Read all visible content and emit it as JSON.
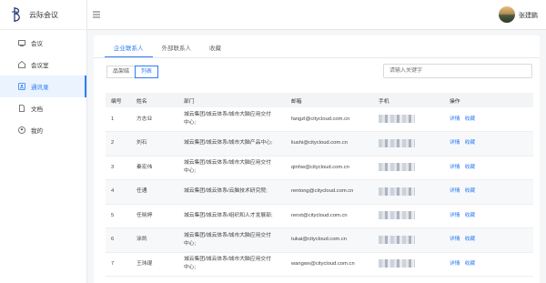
{
  "app": {
    "title": "云际会议"
  },
  "sidebar": {
    "items": [
      {
        "label": "会议",
        "icon": "meeting-icon",
        "active": false
      },
      {
        "label": "会议室",
        "icon": "room-icon",
        "active": false
      },
      {
        "label": "通讯录",
        "icon": "contacts-icon",
        "active": true
      },
      {
        "label": "文档",
        "icon": "document-icon",
        "active": false
      },
      {
        "label": "我的",
        "icon": "user-icon",
        "active": false
      }
    ]
  },
  "header": {
    "username": "张建鹏"
  },
  "tabs": [
    {
      "label": "企业联系人",
      "active": true
    },
    {
      "label": "外部联系人",
      "active": false
    },
    {
      "label": "收藏",
      "active": false
    }
  ],
  "view_toggle": {
    "org_label": "品架结",
    "list_label": "列表"
  },
  "search": {
    "placeholder": "请输入关键字"
  },
  "table": {
    "headers": [
      "编号",
      "姓名",
      "部门",
      "邮箱",
      "手机",
      "操作"
    ],
    "rows": [
      {
        "no": "1",
        "name": "方志业",
        "dept": "城云集团/城云体系/城市大脑应用交付中心;",
        "email": "fangzl@citycloud.com.cn"
      },
      {
        "no": "2",
        "name": "刘石",
        "dept": "城云集团/城云体系/城市大脑产品中心;",
        "email": "liushi@citycloud.com.cn"
      },
      {
        "no": "3",
        "name": "秦宏伟",
        "dept": "城云集团/城云体系/城市大脑应用交付中心;",
        "email": "qinhw@citycloud.com.cn"
      },
      {
        "no": "4",
        "name": "任通",
        "dept": "城云集团/城云体系/云脑技术研究院;",
        "email": "rentong@citycloud.com.cn"
      },
      {
        "no": "5",
        "name": "任晓婷",
        "dept": "城云集团/城云体系/组织和人才发展部;",
        "email": "renxt@citycloud.com.cn"
      },
      {
        "no": "6",
        "name": "涂凯",
        "dept": "城云集团/城云体系/城市大脑应用交付中心;",
        "email": "tukai@citycloud.com.cn"
      },
      {
        "no": "7",
        "name": "王玮琨",
        "dept": "城云集团/城云体系/城市大脑应用交付中心;",
        "email": "wangwx@citycloud.com.cn"
      }
    ],
    "actions": {
      "detail": "详情",
      "favorite": "收藏"
    }
  },
  "colors": {
    "accent": "#2e7cf6",
    "sidebar_active_bg": "#eaf3fe"
  }
}
